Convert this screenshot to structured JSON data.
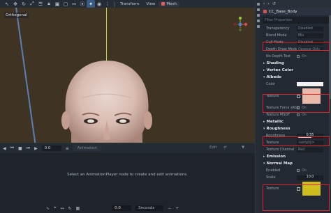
{
  "toolbar": {
    "menus": {
      "transform": "Transform",
      "view": "View",
      "mesh": "Mesh"
    }
  },
  "viewport": {
    "label": "Orthogonal"
  },
  "animation": {
    "time": "0.0",
    "animation_dropdown": "Animation",
    "edit": "Edit",
    "message": "Select an AnimationPlayer node to create and edit animations.",
    "footer_time": "0.0",
    "footer_unit": "Seconds"
  },
  "inspector": {
    "node_name": "CC_Base_Body",
    "filter_placeholder": "Filter Properties",
    "rows": {
      "transparency": {
        "label": "Transparency",
        "value": "Disabled"
      },
      "blend_mode": {
        "label": "Blend Mode",
        "value": "Mix"
      },
      "cull_mode": {
        "label": "Cull Mode",
        "value": "Disabled"
      },
      "depth_draw": {
        "label": "Depth Draw Mode",
        "value": "Opaque Only"
      },
      "no_depth": {
        "label": "No Depth Test",
        "value": "On"
      }
    },
    "sections": {
      "shading": "Shading",
      "vertex_color": "Vertex Color",
      "albedo": "Albedo",
      "metallic": "Metallic",
      "roughness": "Roughness",
      "emission": "Emission",
      "normal_map": "Normal Map"
    },
    "albedo": {
      "color_label": "Color",
      "texture_label": "Texture",
      "force_srgb_label": "Texture Force sRGB",
      "force_srgb_value": "On",
      "msdf_label": "Texture MSDF",
      "msdf_value": "On"
    },
    "roughness": {
      "roughness_label": "Roughness",
      "roughness_value": 0.55,
      "roughness_text": "0.55",
      "texture_label": "Texture",
      "texture_value": "<empty>",
      "channel_label": "Texture Channel",
      "channel_value": "Red"
    },
    "normal": {
      "enabled_label": "Enabled",
      "enabled_value": "On",
      "scale_label": "Scale",
      "scale_text": "10.0",
      "texture_label": "Texture"
    }
  }
}
